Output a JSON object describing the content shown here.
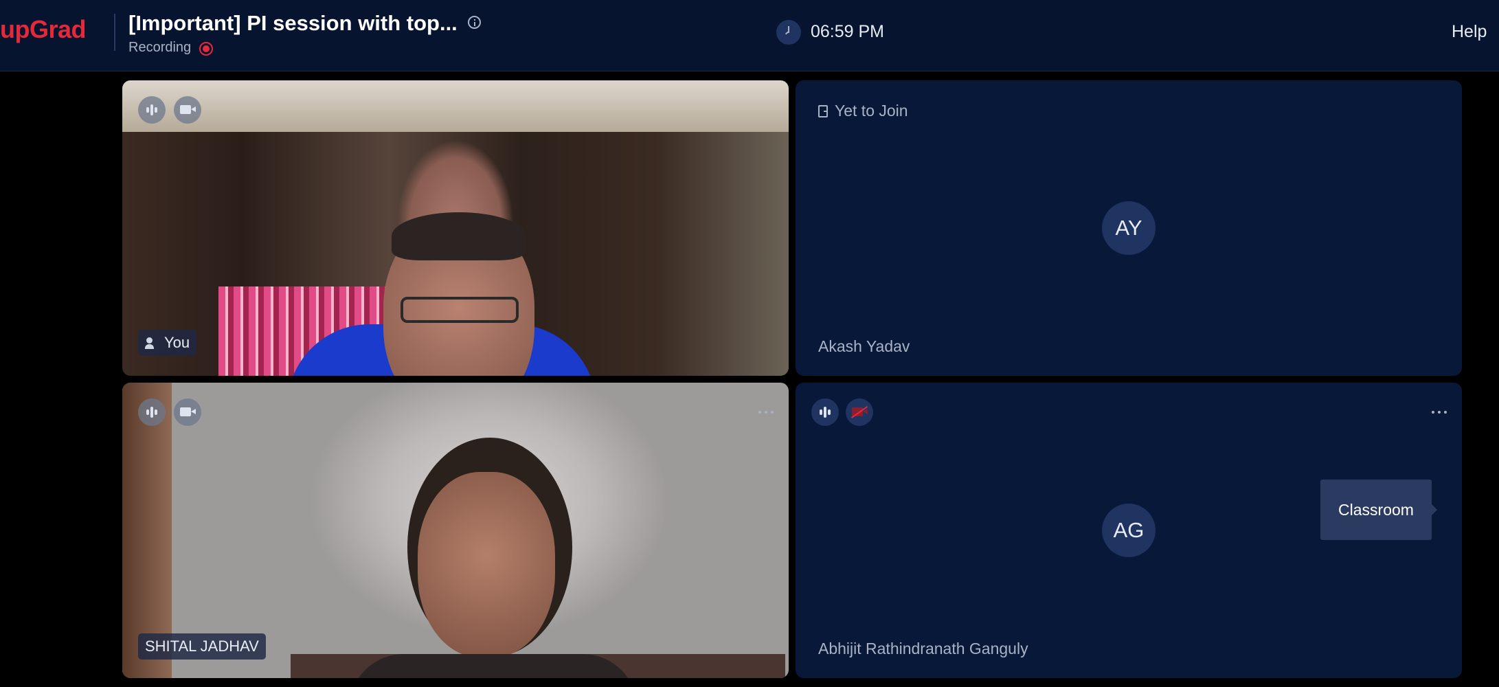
{
  "header": {
    "logo": "upGrad",
    "title": "[Important] PI session with top...",
    "recording": "Recording",
    "time": "06:59 PM",
    "help": "Help"
  },
  "tiles": [
    {
      "name": "You",
      "video": true,
      "status_icons": [
        "mic-icon",
        "camera-icon"
      ]
    },
    {
      "name": "Akash Yadav",
      "initials": "AY",
      "status": "Yet to Join"
    },
    {
      "name": "SHITAL JADHAV",
      "video": true,
      "status_icons": [
        "mic-icon",
        "camera-icon",
        "more-icon"
      ]
    },
    {
      "name": "Abhijit Rathindranath Ganguly",
      "initials": "AG",
      "status_icons": [
        "mic-icon",
        "camera-off-icon",
        "more-icon"
      ]
    }
  ],
  "tooltip": {
    "label": "Classroom"
  },
  "colors": {
    "header_bg": "#071430",
    "tile_bg": "#081838",
    "accent": "#e5293a"
  }
}
